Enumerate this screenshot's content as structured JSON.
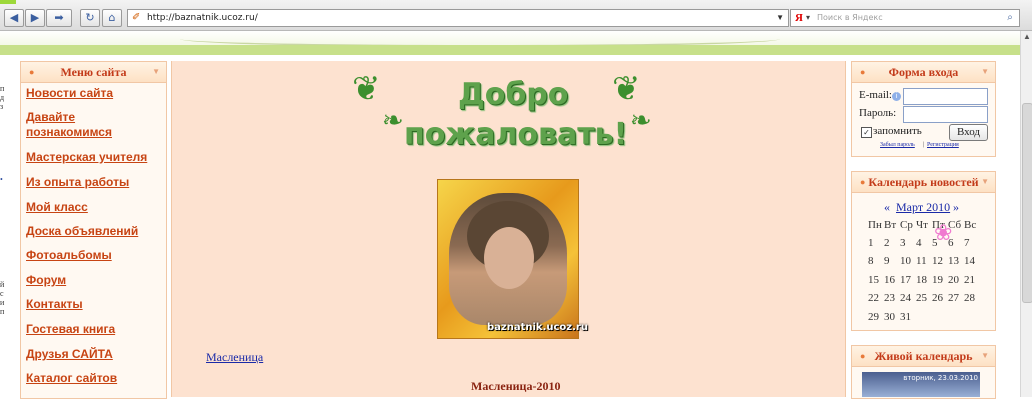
{
  "browser": {
    "url": "http://baznatnik.ucoz.ru/",
    "search_engine_logo": "Я",
    "search_placeholder": "Поиск в Яндекс",
    "icons": [
      "back-icon",
      "forward-icon",
      "forward-menu-icon",
      "reload-icon",
      "home-icon",
      "favicon-icon",
      "dropdown-icon",
      "yandex-dropdown-icon",
      "magnifier-icon"
    ]
  },
  "site_menu": {
    "title": "Меню сайта",
    "items": [
      "Новости сайта",
      "Давайте познакомимся",
      "Мастерская учителя",
      "Из опыта работы",
      "Мой класс",
      "Доска объявлений",
      "Фотоальбомы",
      "Форум",
      "Контакты",
      "Гостевая книга",
      "Друзья САЙТА",
      "Каталог сайтов"
    ]
  },
  "main": {
    "welcome_line1": "Добро",
    "welcome_line2": "пожаловать!",
    "photo_watermark": "baznatnik.ucoz.ru",
    "link": "Масленица",
    "heading": "Масленица-2010"
  },
  "login_form": {
    "title": "Форма входа",
    "email_label": "E-mail:",
    "password_label": "Пароль:",
    "email_value": "",
    "password_value": "",
    "remember_label": "запомнить",
    "remember_checked": true,
    "submit_label": "Вход",
    "forgot_link": "Забыл пароль",
    "separator": "|",
    "register_link": "Регистрация"
  },
  "calendar": {
    "title": "Календарь новостей",
    "prev": "«",
    "month": "Март 2010",
    "next": "»",
    "weekdays": [
      "Пн",
      "Вт",
      "Ср",
      "Чт",
      "Пт",
      "Сб",
      "Вс"
    ],
    "rows": [
      [
        "1",
        "2",
        "3",
        "4",
        "5",
        "6",
        "7"
      ],
      [
        "8",
        "9",
        "10",
        "11",
        "12",
        "13",
        "14"
      ],
      [
        "15",
        "16",
        "17",
        "18",
        "19",
        "20",
        "21"
      ],
      [
        "22",
        "23",
        "24",
        "25",
        "26",
        "27",
        "28"
      ],
      [
        "29",
        "30",
        "31",
        "",
        "",
        "",
        ""
      ]
    ]
  },
  "live_calendar": {
    "title": "Живой календарь",
    "caption": "вторник, 23.03.2010"
  },
  "colors": {
    "accent_text": "#c33b1a",
    "menu_link": "#c74413",
    "content_bg": "#fde2d0",
    "box_border": "#f1c7a5",
    "band_green": "#c7e08a"
  }
}
